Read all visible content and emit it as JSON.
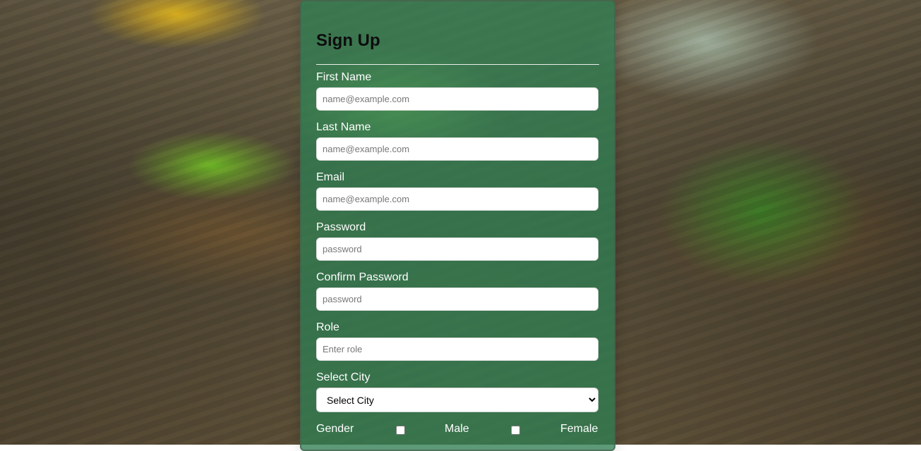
{
  "form": {
    "title": "Sign Up",
    "fields": {
      "first_name": {
        "label": "First Name",
        "placeholder": "name@example.com"
      },
      "last_name": {
        "label": "Last Name",
        "placeholder": "name@example.com"
      },
      "email": {
        "label": "Email",
        "placeholder": "name@example.com"
      },
      "password": {
        "label": "Password",
        "placeholder": "password"
      },
      "confirm_password": {
        "label": "Confirm Password",
        "placeholder": "password"
      },
      "role": {
        "label": "Role",
        "placeholder": "Enter role"
      },
      "city": {
        "label": "Select City",
        "selected": "Select City"
      }
    },
    "gender": {
      "label": "Gender",
      "options": [
        "Male",
        "Female"
      ]
    }
  },
  "colors": {
    "card_background": "#307e52",
    "input_background": "#ffffff",
    "label_text": "#ffffff",
    "title_text": "#0d0d0d"
  },
  "icons": {
    "select_arrow": "chevron-down-icon"
  }
}
